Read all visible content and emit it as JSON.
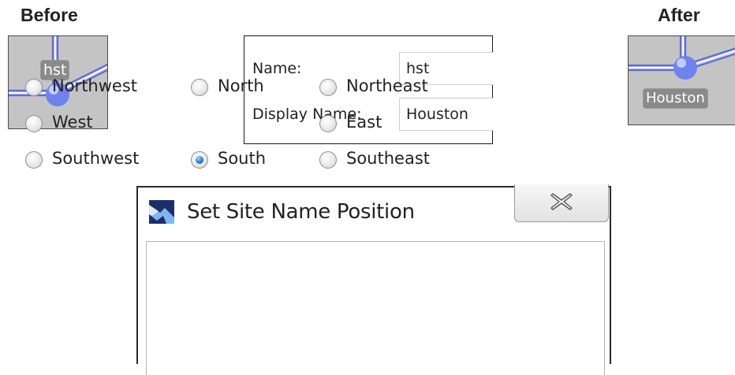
{
  "before": {
    "heading": "Before",
    "tag": "hst"
  },
  "after": {
    "heading": "After",
    "tag": "Houston"
  },
  "name_panel": {
    "name_label": "Name:",
    "name_value": "hst",
    "display_name_label": "Display Name:",
    "display_name_value": "Houston"
  },
  "dialog": {
    "title": "Set Site Name Position",
    "options": [
      {
        "label": "Northwest",
        "checked": false
      },
      {
        "label": "North",
        "checked": false
      },
      {
        "label": "Northeast",
        "checked": false
      },
      {
        "label": "West",
        "checked": false
      },
      {
        "label": "East",
        "checked": false
      },
      {
        "label": "Southwest",
        "checked": false
      },
      {
        "label": "South",
        "checked": true
      },
      {
        "label": "Southeast",
        "checked": false
      }
    ]
  },
  "colors": {
    "link_line": "#5a6ae0",
    "node": "#6f82ee",
    "thumb_bg": "#c4c4c4",
    "radio_selected": "#2a7fc6"
  },
  "icons": {
    "app_icon": "network-logo-icon",
    "close_icon": "close-x-icon"
  }
}
